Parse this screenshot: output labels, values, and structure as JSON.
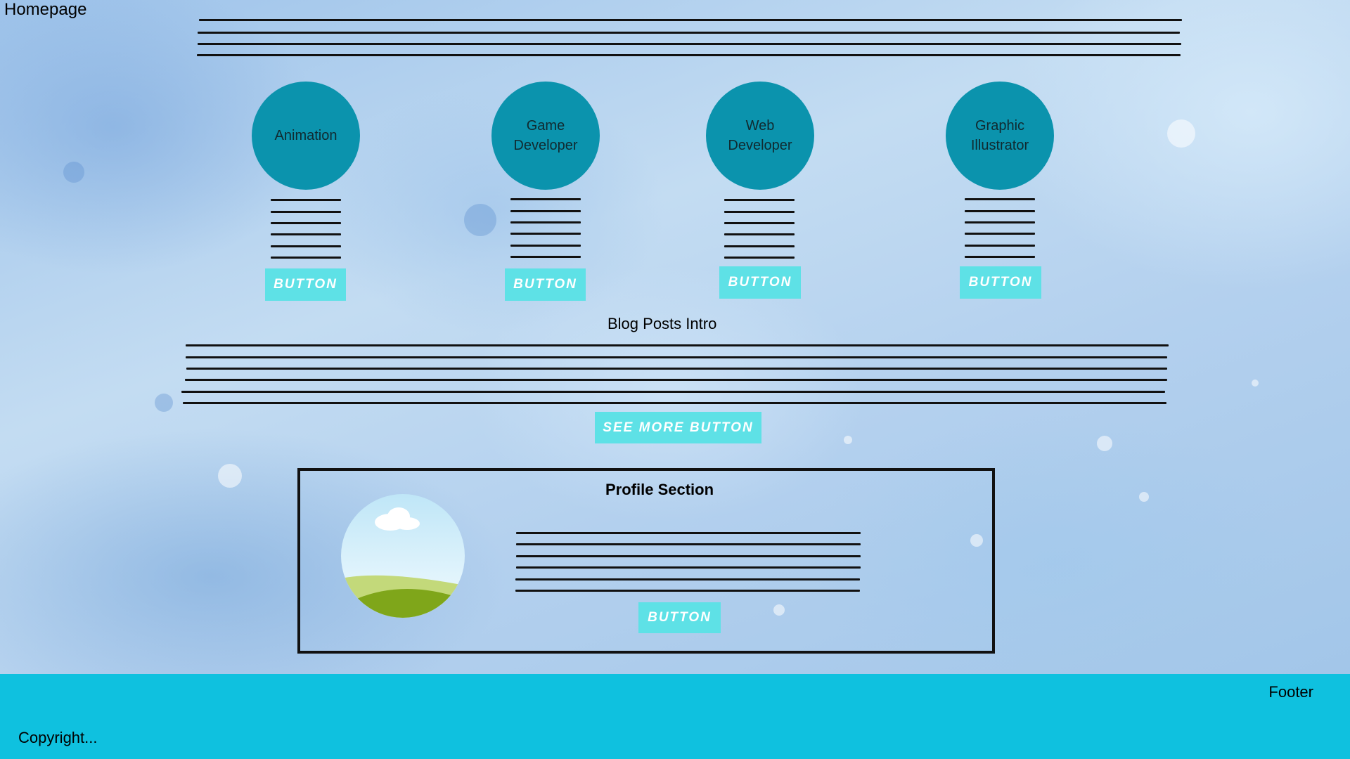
{
  "page": {
    "title": "Homepage"
  },
  "categories": [
    {
      "label": "Animation",
      "button": "BUTTON"
    },
    {
      "label": "Game\nDeveloper",
      "button": "BUTTON"
    },
    {
      "label": "Web\nDeveloper",
      "button": "BUTTON"
    },
    {
      "label": "Graphic\nIllustrator",
      "button": "BUTTON"
    }
  ],
  "blog": {
    "intro": "Blog Posts Intro",
    "see_more": "SEE MORE BUTTON"
  },
  "profile": {
    "title": "Profile Section",
    "button": "BUTTON"
  },
  "footer": {
    "label": "Footer",
    "copyright": "Copyright..."
  },
  "colors": {
    "circle": "#0b93ad",
    "button": "#5ee1e6",
    "footer": "#0fc1df"
  }
}
